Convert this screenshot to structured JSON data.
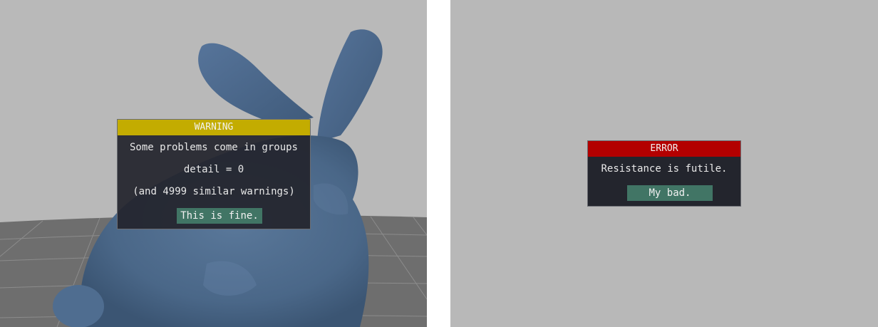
{
  "warning": {
    "title": "WARNING",
    "lines": [
      "Some problems come in groups",
      "detail = 0",
      "(and 4999 similar warnings)"
    ],
    "button_label": "This is fine."
  },
  "error": {
    "title": "ERROR",
    "message": "Resistance is futile.",
    "button_label": "My bad."
  },
  "colors": {
    "warning_header": "#c3ac00",
    "error_header": "#b30000",
    "button": "#417565",
    "dialog_bg": "#23252d",
    "viewport_bg": "#b9b9b9",
    "bunny": "#4a6788"
  }
}
